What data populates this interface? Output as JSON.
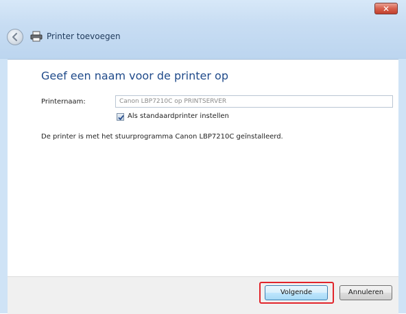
{
  "window": {
    "title": "Printer toevoegen",
    "close_symbol": "✕"
  },
  "page": {
    "heading": "Geef een naam voor de printer op",
    "printer_name_label": "Printernaam:",
    "printer_name_value": "Canon LBP7210C op PRINTSERVER",
    "default_checkbox_label": "Als standaardprinter instellen",
    "default_checkbox_checked": true,
    "info": "De printer is met het stuurprogramma Canon LBP7210C geïnstalleerd."
  },
  "buttons": {
    "next": "Volgende",
    "cancel": "Annuleren"
  },
  "icons": {
    "back": "back-arrow-icon",
    "printer": "printer-icon",
    "close": "close-icon"
  },
  "colors": {
    "highlight": "#e1242a",
    "heading": "#1f4a8a"
  }
}
